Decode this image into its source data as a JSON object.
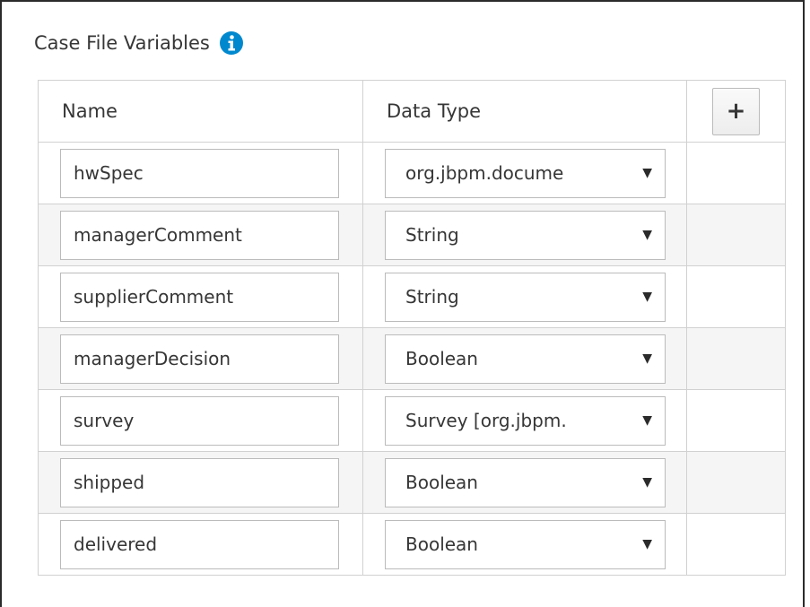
{
  "panel": {
    "title": "Case File Variables",
    "info_icon": "info-circle-icon",
    "accent_color": "#0088ce"
  },
  "table": {
    "columns": {
      "name": "Name",
      "data_type": "Data Type",
      "add_label": "+"
    },
    "rows": [
      {
        "name": "hwSpec",
        "type": "org.jbpm.docume"
      },
      {
        "name": "managerComment",
        "type": "String"
      },
      {
        "name": "supplierComment",
        "type": "String"
      },
      {
        "name": "managerDecision",
        "type": "Boolean"
      },
      {
        "name": "survey",
        "type": "Survey [org.jbpm."
      },
      {
        "name": "shipped",
        "type": "Boolean"
      },
      {
        "name": "delivered",
        "type": "Boolean"
      }
    ],
    "dropdown_icon": "caret-down-icon",
    "dropdown_glyph": "▼"
  }
}
